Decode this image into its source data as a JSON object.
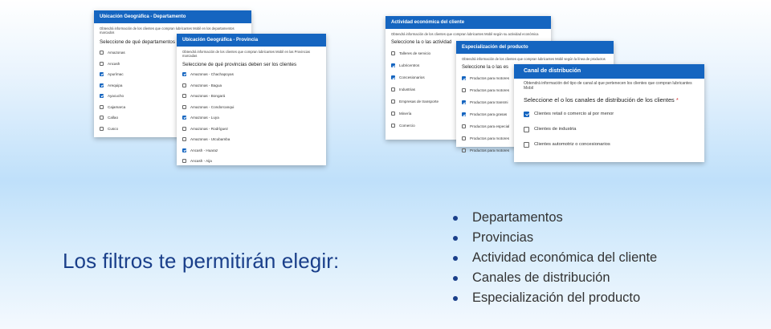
{
  "headline": "Los filtros te permitirán elegir:",
  "bullets": [
    "Departamentos",
    "Provincias",
    "Actividad económica del cliente",
    "Canales de distribución",
    "Especialización del producto"
  ],
  "card_departamento": {
    "title": "Ubicación Geográfica - Departamento",
    "description": "Obtendrá información de los clientes que compran lubricantes Mobil en los departamentos marcados",
    "question": "Seleccione de qué departamentos",
    "options": [
      {
        "label": "Amazonas",
        "checked": false
      },
      {
        "label": "Ancash",
        "checked": false
      },
      {
        "label": "Apurímac",
        "checked": true
      },
      {
        "label": "Arequipa",
        "checked": true
      },
      {
        "label": "Ayacucho",
        "checked": true
      },
      {
        "label": "Cajamarca",
        "checked": false
      },
      {
        "label": "Callao",
        "checked": false
      },
      {
        "label": "Cusco",
        "checked": false
      }
    ]
  },
  "card_provincia": {
    "title": "Ubicación Geográfica - Provincia",
    "description": "Obtendrá información de los clientes que compran lubricantes Mobil en las Provincias marcadas",
    "question": "Seleccione de qué provincias deben ser los clientes",
    "options": [
      {
        "label": "Amazonas - Chachapoyas",
        "checked": true
      },
      {
        "label": "Amazonas - Bagua",
        "checked": false
      },
      {
        "label": "Amazonas - Bongará",
        "checked": false
      },
      {
        "label": "Amazonas - Condorcanqui",
        "checked": false
      },
      {
        "label": "Amazonas - Luya",
        "checked": true
      },
      {
        "label": "Amazonas - Rodríguez",
        "checked": false
      },
      {
        "label": "Amazonas - Utcubamba",
        "checked": false
      },
      {
        "label": "Ancash - Huaraz",
        "checked": true
      },
      {
        "label": "Ancash - Aija",
        "checked": false
      }
    ]
  },
  "card_actividad": {
    "title": "Actividad económica del cliente",
    "description": "Obtendrá información de los clientes que compran lubricantes Mobil según su actividad económica",
    "question": "Seleccione la o las actividad",
    "options": [
      {
        "label": "Talleres de servicio",
        "checked": false
      },
      {
        "label": "Lubricentros",
        "checked": true
      },
      {
        "label": "Concesionarios",
        "checked": true
      },
      {
        "label": "Industrias",
        "checked": false
      },
      {
        "label": "Empresas de transporte",
        "checked": false
      },
      {
        "label": "Minería",
        "checked": false
      },
      {
        "label": "Comercio",
        "checked": false
      }
    ]
  },
  "card_especializacion": {
    "title": "Especialización del producto",
    "description": "Obtendrá información de los clientes que compran lubricantes Mobil según la línea de productos",
    "question": "Seleccione la o las es",
    "options": [
      {
        "label": "Productos para motores",
        "checked": true
      },
      {
        "label": "Productos para motores",
        "checked": false
      },
      {
        "label": "Productos para transmi",
        "checked": true
      },
      {
        "label": "Productos para grasas",
        "checked": true
      },
      {
        "label": "Productos para especial",
        "checked": false
      },
      {
        "label": "Productos para motores",
        "checked": false
      },
      {
        "label": "Productos para motores",
        "checked": false
      }
    ]
  },
  "card_canal": {
    "title": "Canal de distribución",
    "description": "Obtendrá información del tipo de canal al que pertenecen los clientes que compran lubricantes Mobil",
    "question": "Seleccione el o los canales de distribución de los clientes",
    "required_mark": "*",
    "options": [
      {
        "label": "Clientes retail o comercio al por menor",
        "checked": true
      },
      {
        "label": "Clientes de industria",
        "checked": false
      },
      {
        "label": "Clientes automotriz o concesionarios",
        "checked": false
      }
    ]
  }
}
